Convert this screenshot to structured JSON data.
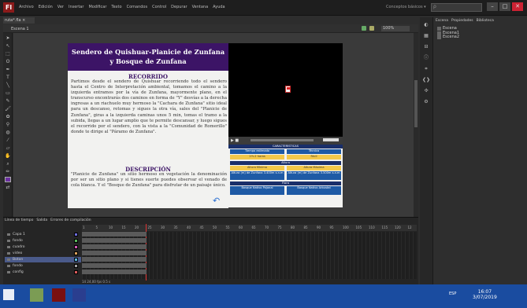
{
  "menubar": {
    "logo": "Fl",
    "menus": [
      "Archivo",
      "Edición",
      "Ver",
      "Insertar",
      "Modificar",
      "Texto",
      "Comandos",
      "Control",
      "Depurar",
      "Ventana",
      "Ayuda"
    ],
    "workspace": "Conceptos básicos ▾",
    "search_placeholder": "ρ",
    "window_buttons": [
      "–",
      "□",
      "✕"
    ]
  },
  "document": {
    "tab": "ruta*.fla ×",
    "scene": "Escena 1",
    "zoom": "100%"
  },
  "content": {
    "title_line1": "Sendero de Quishuar-Planicie de Zunfana",
    "title_line2": "y Bosque de Zunfana",
    "recorrido_heading": "RECORRIDO",
    "recorrido_text": "Partimos desde el sendero de Quishuar recorriendo todo el sendero hasta el Centro de Interpretación ambiental, tomamos el camino a la izquierda entramos por la vía de Zunfana, mayormente plano, en el transcurso encontrarás dos caminos en forma de \"Y\" desvías a la derecha ingresas a un riachuelo muy hermoso la \"Cachara de Zunfana\" sitio ideal para un descanso, retomas y sigues la otra vía, sales del \"Planicie de Zunfana\", giras a la izquierda caminas unos 5 min, tomas el tramo a la subida, llegas a un lugar amplio que te permite descansar, y luego sigues el recorrido por el sendero, con la vista a la \"Comunidad de Romerillo\" donde te dirige al \"Páramo de Zunfana\".",
    "descripcion_heading": "DESCRIPCIÓN",
    "descripcion_text": "\"Planicie de Zunfana\" un sitio hermoso en vegetación la denominación por ser un sitio plano y si tienes suerte puedes observar el venado de cola blanca. Y el \"Bosque de Zunfana\" para disfrutar de un paisaje único."
  },
  "table": {
    "header": "CARACTERÍSTICAS",
    "rows": [
      [
        "Tiempo estimado",
        "Técnica"
      ],
      [
        "1½-2 horas",
        "Fácil"
      ],
      [
        "Altura"
      ],
      [
        "Altura Mínima",
        "Altura Máxima"
      ],
      [
        "Altura (m) de Zunfana 3.400m s.n.m",
        "Altura (m) de Zunfana 3.500m s.n.m"
      ],
      [
        "Flora"
      ],
      [
        "Bosque Nativo Pajonal",
        "Bosque Nativo Arbustal"
      ]
    ]
  },
  "library": {
    "tabs": [
      "Escena",
      "Propiedades",
      "Biblioteca"
    ],
    "items": [
      "Escena",
      "Escena1",
      "Escena2"
    ]
  },
  "timeline": {
    "tabs": [
      "Línea de tiempo",
      "Salida",
      "Errores de compilación"
    ],
    "ruler": [
      "1",
      "5",
      "10",
      "15",
      "20",
      "25",
      "30",
      "35",
      "40",
      "45",
      "50",
      "55",
      "60",
      "65",
      "70",
      "75",
      "80",
      "85",
      "90",
      "95",
      "100",
      "105",
      "110",
      "115",
      "120",
      "12"
    ],
    "layers": [
      "Capa 1",
      "fondo",
      "cuadro",
      "video",
      "Boton",
      "fondo",
      "config"
    ],
    "footer": "14  24,00 fps  0.5 s"
  },
  "taskbar": {
    "time": "16:07",
    "date": "3/07/2019",
    "lang": "ESP"
  }
}
